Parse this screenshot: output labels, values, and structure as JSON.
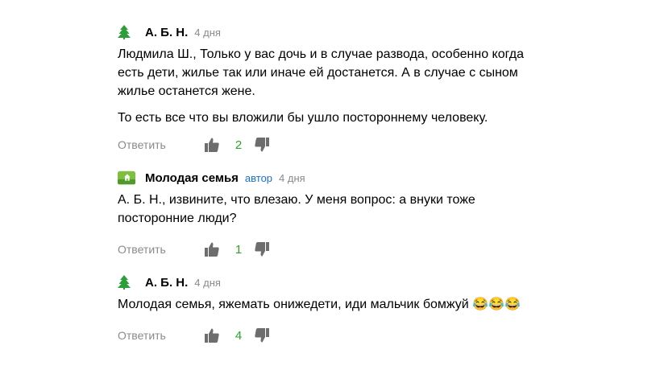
{
  "comments": [
    {
      "author": "А. Б. Н.",
      "badge": "",
      "time": "4 дня",
      "avatar_icon": "tree-icon",
      "paragraphs": [
        "Людмила Ш., Только у вас дочь и в случае развода, особенно когда есть дети, жилье так или иначе ей достанется. А в случае с сыном жилье останется жене.",
        "То есть все что вы вложили бы ушло постороннему человеку."
      ],
      "reply_label": "Ответить",
      "likes": "2"
    },
    {
      "author": "Молодая семья",
      "badge": "автор",
      "time": "4 дня",
      "avatar_icon": "house-logo-icon",
      "paragraphs": [
        "А. Б. Н., извините, что влезаю. У меня вопрос: а внуки тоже посторонние люди?"
      ],
      "reply_label": "Ответить",
      "likes": "1"
    },
    {
      "author": "А. Б. Н.",
      "badge": "",
      "time": "4 дня",
      "avatar_icon": "tree-icon",
      "paragraphs": [
        "Молодая семья, яжемать онижедети, иди мальчик бомжуй 😂😂😂"
      ],
      "reply_label": "Ответить",
      "likes": "4"
    }
  ],
  "colors": {
    "like_count": "#2aa52a",
    "badge": "#1a6fd1",
    "muted": "#8a8a8a",
    "tree": "#2e9e3a"
  }
}
